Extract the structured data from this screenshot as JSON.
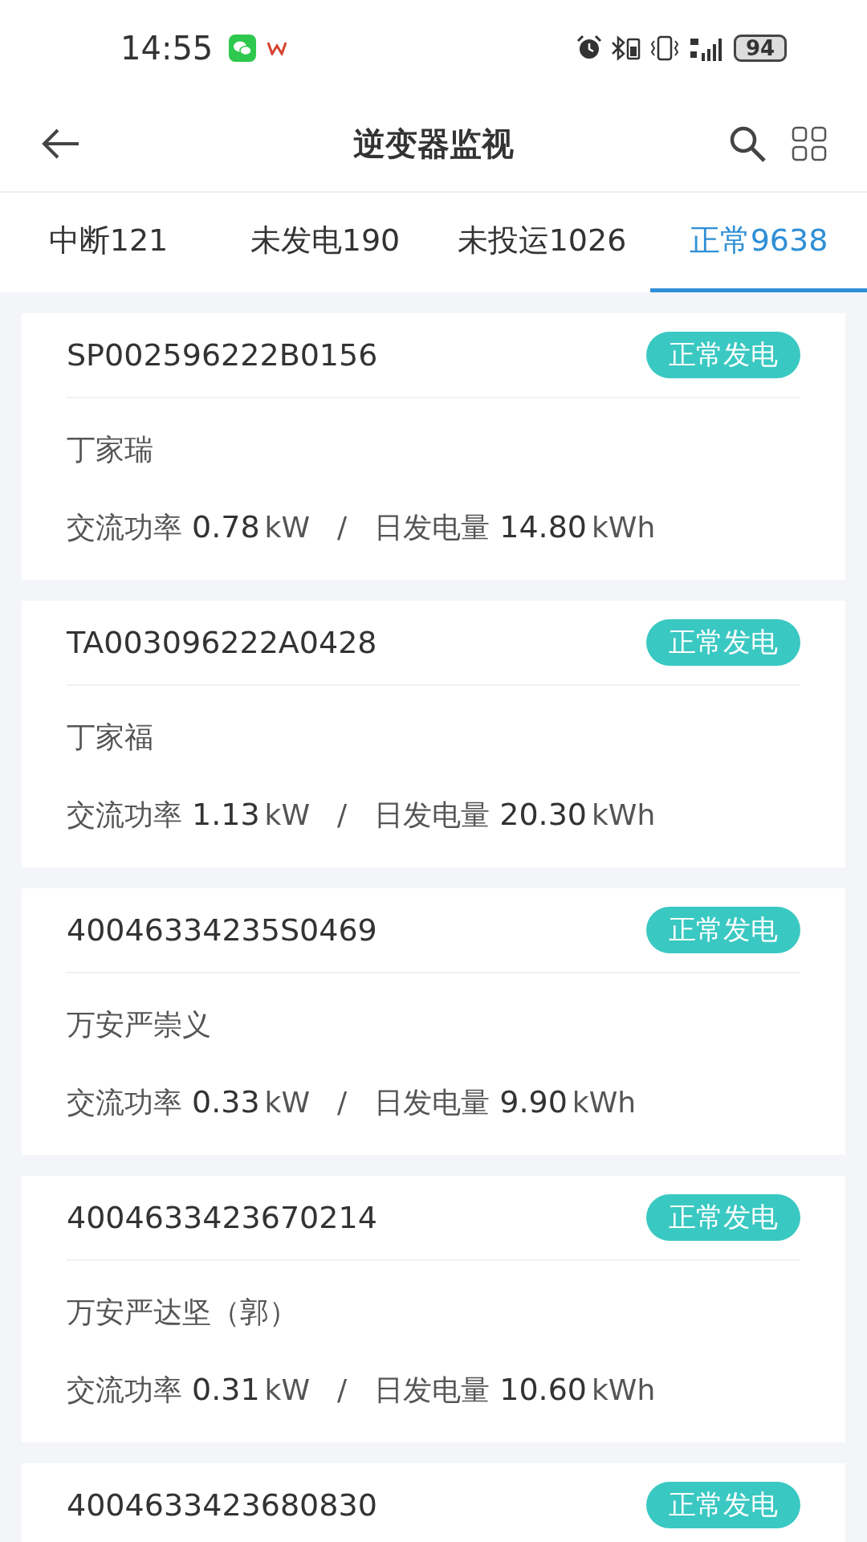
{
  "status_bar": {
    "time": "14:55",
    "battery": "94"
  },
  "header": {
    "title": "逆变器监视"
  },
  "tabs": [
    {
      "label": "中断121",
      "selected": false
    },
    {
      "label": "未发电190",
      "selected": false
    },
    {
      "label": "未投运1026",
      "selected": false
    },
    {
      "label": "正常9638",
      "selected": true
    }
  ],
  "inverters": [
    {
      "id": "SP002596222B0156",
      "status": "正常发电",
      "owner": "丁家瑞",
      "power_label": "交流功率",
      "power": "0.78",
      "power_unit": "kW",
      "separator": "/",
      "energy_label": "日发电量",
      "energy": "14.80",
      "energy_unit": "kWh"
    },
    {
      "id": "TA003096222A0428",
      "status": "正常发电",
      "owner": "丁家福",
      "power_label": "交流功率",
      "power": "1.13",
      "power_unit": "kW",
      "separator": "/",
      "energy_label": "日发电量",
      "energy": "20.30",
      "energy_unit": "kWh"
    },
    {
      "id": "40046334235S0469",
      "status": "正常发电",
      "owner": "万安严崇义",
      "power_label": "交流功率",
      "power": "0.33",
      "power_unit": "kW",
      "separator": "/",
      "energy_label": "日发电量",
      "energy": "9.90",
      "energy_unit": "kWh"
    },
    {
      "id": "4004633423670214",
      "status": "正常发电",
      "owner": "万安严达坚（郭）",
      "power_label": "交流功率",
      "power": "0.31",
      "power_unit": "kW",
      "separator": "/",
      "energy_label": "日发电量",
      "energy": "10.60",
      "energy_unit": "kWh"
    },
    {
      "id": "4004633423680830",
      "status": "正常发电"
    }
  ]
}
